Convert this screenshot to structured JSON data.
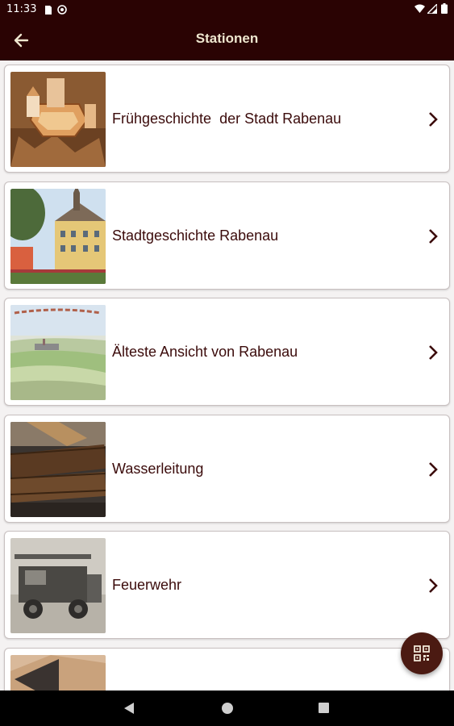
{
  "status_bar": {
    "time": "11:33",
    "icons": [
      "sim-card-icon",
      "at-sign-icon",
      "wifi-icon",
      "signal-icon",
      "battery-icon"
    ]
  },
  "app_bar": {
    "title": "Stationen",
    "back_icon": "arrow-left-icon"
  },
  "stations": [
    {
      "label": "Frühgeschichte  der Stadt Rabenau",
      "image": "castle-model-image"
    },
    {
      "label": "Stadtgeschichte Rabenau",
      "image": "town-hall-image"
    },
    {
      "label": "Älteste Ansicht von Rabenau",
      "image": "old-town-painting-image"
    },
    {
      "label": "Wasserleitung",
      "image": "wooden-pipe-image"
    },
    {
      "label": "Feuerwehr",
      "image": "fire-truck-photo-image"
    },
    {
      "label": "",
      "image": "exhibit-image"
    }
  ],
  "fab": {
    "icon": "qr-code-icon"
  },
  "nav_bar": {
    "icons": [
      "back-triangle-icon",
      "home-circle-icon",
      "recents-square-icon"
    ]
  },
  "colors": {
    "primary_dark": "#2a0303",
    "title_text": "#efe7cf",
    "label_text": "#3b0b0b",
    "fab": "#4b1a12",
    "background": "#f4f2f2"
  }
}
